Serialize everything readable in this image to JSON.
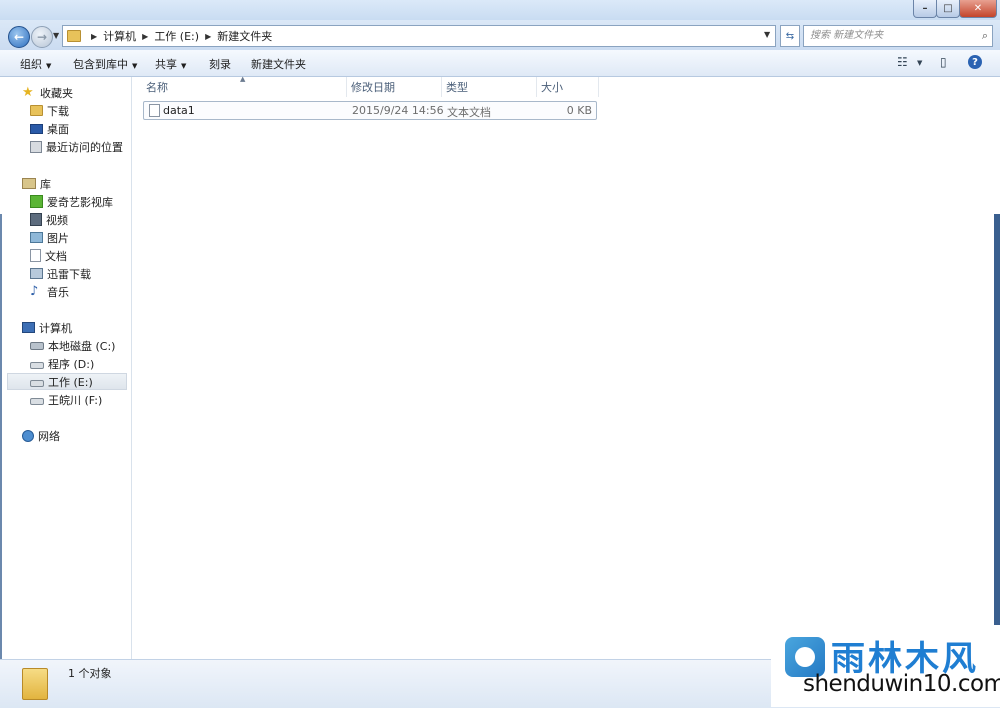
{
  "window": {
    "controls": {
      "minimize": "–",
      "maximize": "□",
      "close": "✕"
    }
  },
  "address": {
    "back_icon": "back-arrow-icon",
    "forward_icon": "forward-arrow-icon",
    "breadcrumbs": [
      "计算机",
      "工作 (E:)",
      "新建文件夹"
    ],
    "search_placeholder": "搜索 新建文件夹"
  },
  "toolbar": {
    "organize": "组织",
    "include_in_library": "包含到库中",
    "share": "共享",
    "burn": "刻录",
    "new_folder": "新建文件夹"
  },
  "nav": {
    "favorites": {
      "label": "收藏夹",
      "items": [
        "下载",
        "桌面",
        "最近访问的位置"
      ]
    },
    "libraries": {
      "label": "库",
      "items": [
        "爱奇艺影视库",
        "视频",
        "图片",
        "文档",
        "迅雷下载",
        "音乐"
      ]
    },
    "computer": {
      "label": "计算机",
      "items": [
        "本地磁盘 (C:)",
        "程序 (D:)",
        "工作 (E:)",
        "王皖川 (F:)"
      ],
      "selected": "工作 (E:)"
    },
    "network": {
      "label": "网络"
    }
  },
  "columns": [
    "名称",
    "修改日期",
    "类型",
    "大小"
  ],
  "files": [
    {
      "name": "data1",
      "modified": "2015/9/24 14:56",
      "type": "文本文档",
      "size": "0 KB"
    }
  ],
  "status": {
    "count_text": "1 个对象"
  },
  "watermark": {
    "title": "雨林木风",
    "url": "shenduwin10.com"
  },
  "colors": {
    "accent": "#2e6fbf",
    "watermark_blue": "#1f7ed2"
  }
}
